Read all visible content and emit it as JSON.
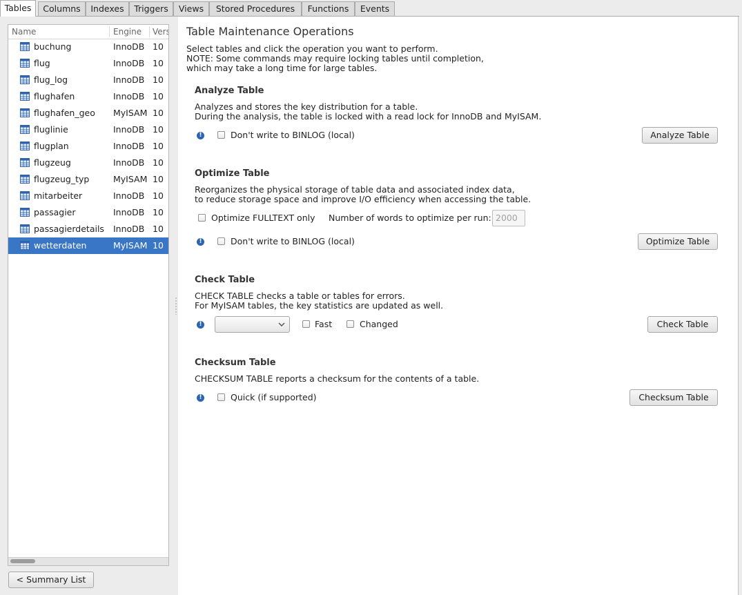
{
  "tabs": [
    "Tables",
    "Columns",
    "Indexes",
    "Triggers",
    "Views",
    "Stored Procedures",
    "Functions",
    "Events"
  ],
  "table_list": {
    "headers": {
      "name": "Name",
      "engine": "Engine",
      "version": "Vers"
    },
    "rows": [
      {
        "name": "buchung",
        "engine": "InnoDB",
        "version": "10"
      },
      {
        "name": "flug",
        "engine": "InnoDB",
        "version": "10"
      },
      {
        "name": "flug_log",
        "engine": "InnoDB",
        "version": "10"
      },
      {
        "name": "flughafen",
        "engine": "InnoDB",
        "version": "10"
      },
      {
        "name": "flughafen_geo",
        "engine": "MyISAM",
        "version": "10"
      },
      {
        "name": "fluglinie",
        "engine": "InnoDB",
        "version": "10"
      },
      {
        "name": "flugplan",
        "engine": "InnoDB",
        "version": "10"
      },
      {
        "name": "flugzeug",
        "engine": "InnoDB",
        "version": "10"
      },
      {
        "name": "flugzeug_typ",
        "engine": "MyISAM",
        "version": "10"
      },
      {
        "name": "mitarbeiter",
        "engine": "InnoDB",
        "version": "10"
      },
      {
        "name": "passagier",
        "engine": "InnoDB",
        "version": "10"
      },
      {
        "name": "passagierdetails",
        "engine": "InnoDB",
        "version": "10"
      },
      {
        "name": "wetterdaten",
        "engine": "MyISAM",
        "version": "10"
      }
    ],
    "selected_index": 12
  },
  "summary_button": "< Summary List",
  "main": {
    "title": "Table Maintenance Operations",
    "intro": [
      "Select tables and click the operation you want to perform.",
      "NOTE: Some commands may require locking tables until completion,",
      "which may take a long time for large tables."
    ],
    "analyze": {
      "heading": "Analyze Table",
      "desc": [
        "Analyzes and stores the key distribution for a table.",
        "During the analysis, the table is locked with a read lock for InnoDB and MyISAM."
      ],
      "binlog_label": "Don't write to BINLOG (local)",
      "button": "Analyze Table"
    },
    "optimize": {
      "heading": "Optimize Table",
      "desc": [
        "Reorganizes the physical storage of table data and associated index data,",
        "to reduce storage space and improve I/O efficiency when accessing the table."
      ],
      "fulltext_label": "Optimize FULLTEXT only",
      "words_label": "Number of words to optimize per run:",
      "words_value": "2000",
      "binlog_label": "Don't write to BINLOG (local)",
      "button": "Optimize Table"
    },
    "check": {
      "heading": "Check Table",
      "desc": [
        "CHECK TABLE checks a table or tables for errors.",
        "For MyISAM tables, the key statistics are updated as well."
      ],
      "select_value": "",
      "fast_label": "Fast",
      "changed_label": "Changed",
      "button": "Check Table"
    },
    "checksum": {
      "heading": "Checksum Table",
      "desc": [
        "CHECKSUM TABLE reports a checksum for the contents of a table."
      ],
      "quick_label": "Quick (if supported)",
      "button": "Checksum Table"
    },
    "info_glyph": "!"
  }
}
